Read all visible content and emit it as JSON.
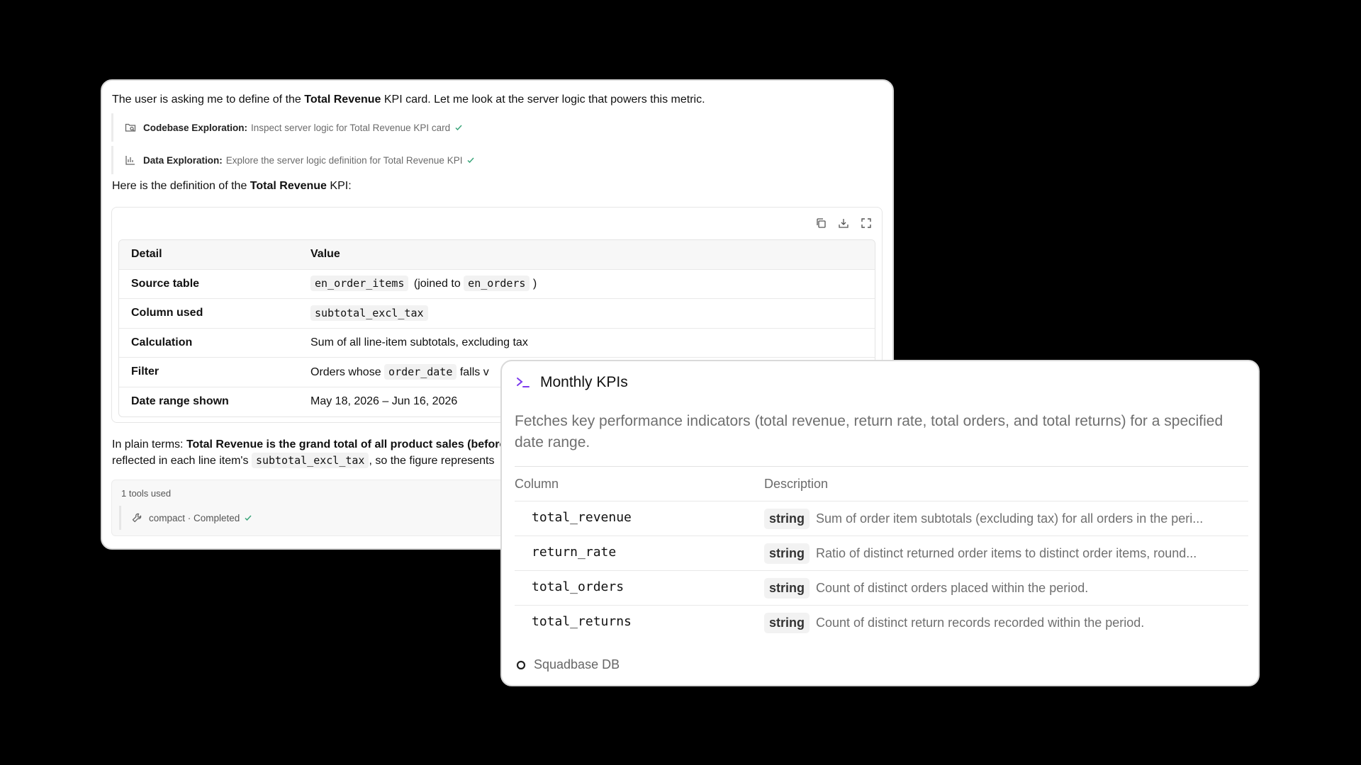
{
  "chat": {
    "intro": {
      "before": "The user is asking me to define of the ",
      "bold": "Total Revenue",
      "after": " KPI card. Let me look at the server logic that powers this metric."
    },
    "steps": [
      {
        "icon": "folder-search-icon",
        "label": "Codebase Exploration:",
        "desc": "Inspect server logic for Total Revenue KPI card"
      },
      {
        "icon": "bar-chart-icon",
        "label": "Data Exploration:",
        "desc": "Explore the server logic definition for Total Revenue KPI"
      }
    ],
    "definition_intro": {
      "before": "Here is the definition of the ",
      "bold": "Total Revenue",
      "after": " KPI:"
    },
    "table": {
      "headers": [
        "Detail",
        "Value"
      ],
      "rows": [
        {
          "detail": "Source table",
          "code1": "en_order_items",
          "mid": "(joined to",
          "code2": "en_orders",
          "end": ")"
        },
        {
          "detail": "Column used",
          "code1": "subtotal_excl_tax"
        },
        {
          "detail": "Calculation",
          "text": "Sum of all line-item subtotals, excluding tax"
        },
        {
          "detail": "Filter",
          "pre": "Orders whose",
          "code1": "order_date",
          "post": "falls v"
        },
        {
          "detail": "Date range shown",
          "text": "May 18, 2026 – Jun 16, 2026"
        }
      ]
    },
    "plain": {
      "line1_before": "In plain terms: ",
      "line1_bold": "Total Revenue is the grand total of all product sales (before",
      "line2_before": "reflected in each line item's ",
      "line2_code": "subtotal_excl_tax",
      "line2_after": ", so the figure represents"
    },
    "tools": {
      "header": "1 tools used",
      "entry": "compact · Completed"
    }
  },
  "kpi_card": {
    "title": "Monthly KPIs",
    "summary": "Fetches key performance indicators (total revenue, return rate, total orders, and total returns) for a specified date range.",
    "headers": [
      "Column",
      "Description"
    ],
    "rows": [
      {
        "column": "total_revenue",
        "type": "string",
        "desc": "Sum of order item subtotals (excluding tax) for all orders in the peri..."
      },
      {
        "column": "return_rate",
        "type": "string",
        "desc": "Ratio of distinct returned order items to distinct order items, round..."
      },
      {
        "column": "total_orders",
        "type": "string",
        "desc": "Count of distinct orders placed within the period."
      },
      {
        "column": "total_returns",
        "type": "string",
        "desc": "Count of distinct return records recorded within the period."
      }
    ],
    "footer": "Squadbase DB"
  },
  "colors": {
    "accent": "#7c3aed",
    "check": "#3aa57a",
    "background": "#000000"
  }
}
